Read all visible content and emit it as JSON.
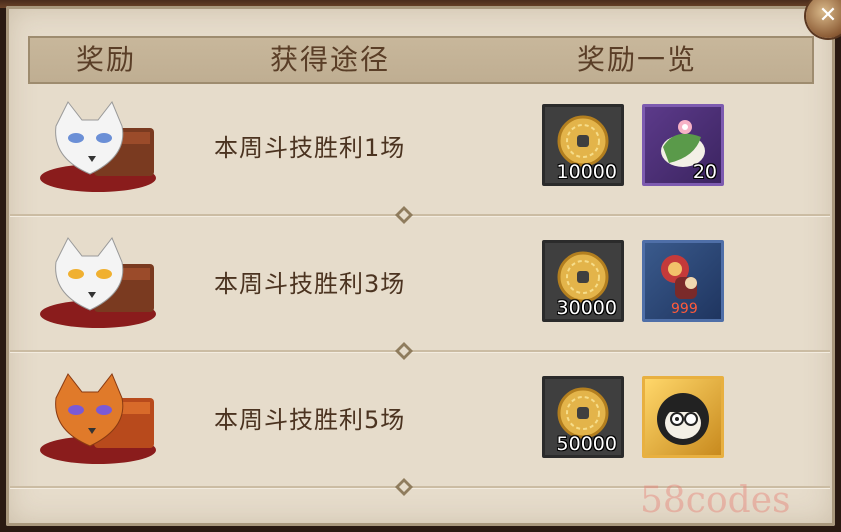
{
  "header": {
    "col_reward": "奖励",
    "col_method": "获得途径",
    "col_overview": "奖励一览"
  },
  "rows": [
    {
      "mask": "white-fox-mask-chest",
      "task": "本周斗技胜利1场",
      "coin_qty": "10000",
      "item": "sakura-mochi",
      "item_qty": "20"
    },
    {
      "mask": "white-fox-mask-chest-gold-eyes",
      "task": "本周斗技胜利3场",
      "coin_qty": "30000",
      "item": "drum-demon-shikigami",
      "item_qty": ""
    },
    {
      "mask": "orange-fox-mask-chest",
      "task": "本周斗技胜利5场",
      "coin_qty": "50000",
      "item": "daruma-avatar-frame",
      "item_qty": ""
    }
  ],
  "close_icon": "close-icon",
  "watermark": "58codes",
  "colors": {
    "panel_bg": "#e6dccb",
    "header_bg": "#c8b79b",
    "text_brown": "#4b3320"
  }
}
